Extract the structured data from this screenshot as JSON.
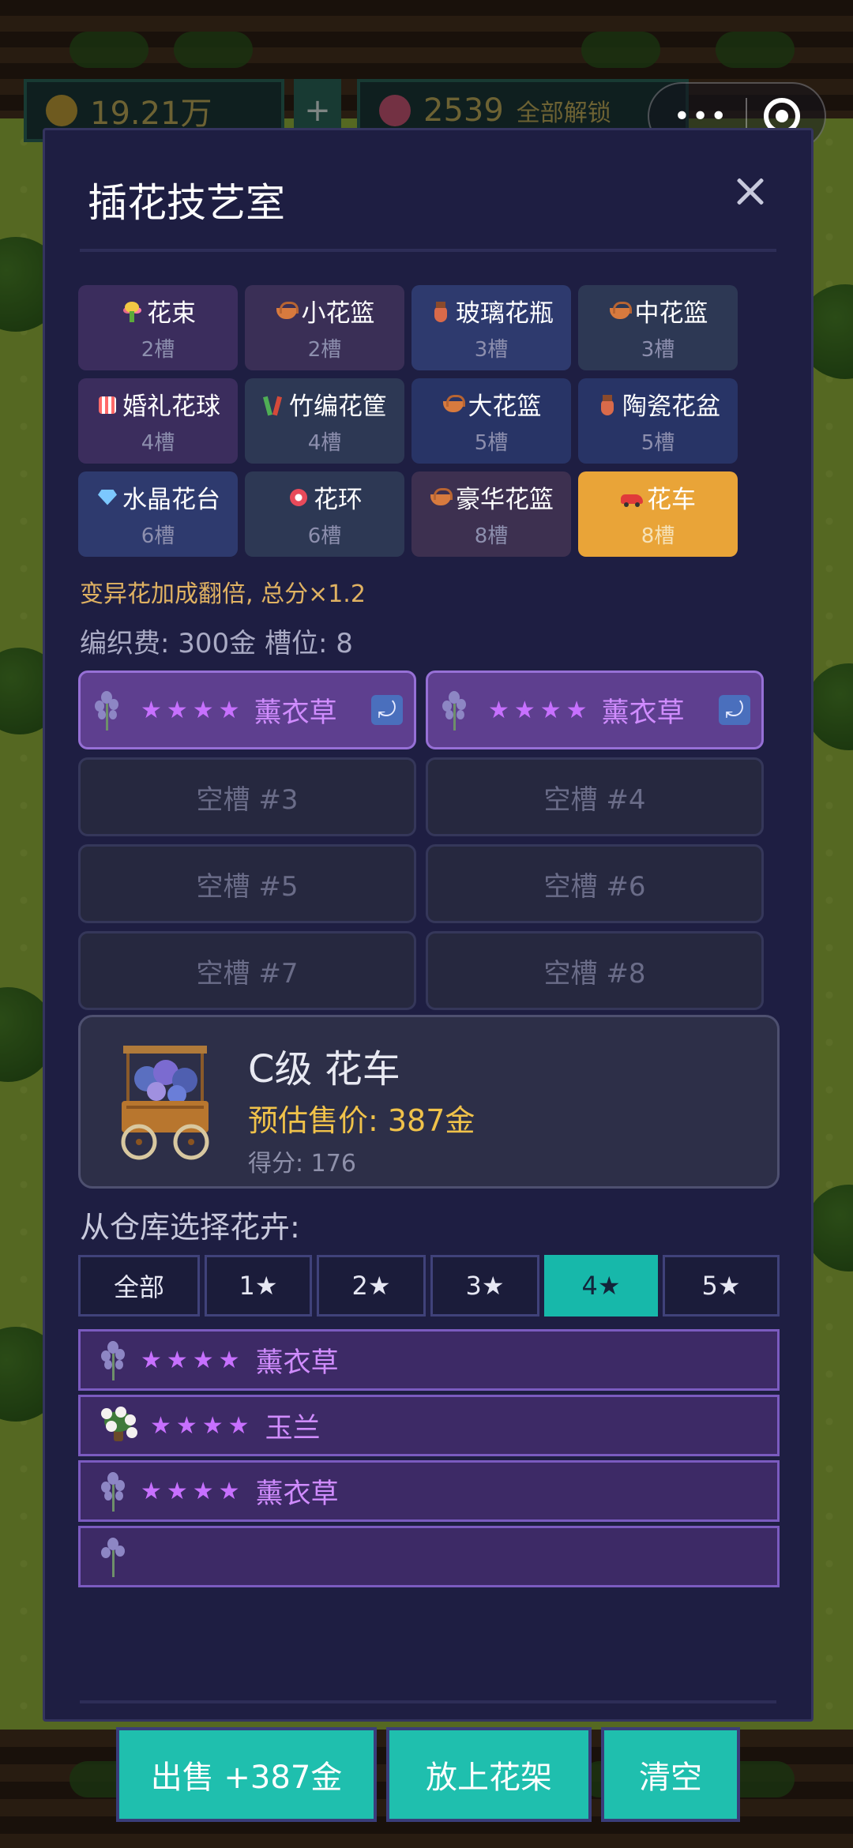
{
  "hud": {
    "coins": "19.21万",
    "plus": "+",
    "flowers": "2539",
    "unlock_all": "全部解锁"
  },
  "modal": {
    "title": "插花技艺室"
  },
  "types": [
    {
      "icon": "bouquet-icon",
      "name": "花束",
      "slots": "2槽"
    },
    {
      "icon": "basket-icon",
      "name": "小花篮",
      "slots": "2槽"
    },
    {
      "icon": "vase-icon",
      "name": "玻璃花瓶",
      "slots": "3槽"
    },
    {
      "icon": "basket-icon",
      "name": "中花篮",
      "slots": "3槽"
    },
    {
      "icon": "wedding-ball-icon",
      "name": "婚礼花球",
      "slots": "4槽"
    },
    {
      "icon": "bamboo-icon",
      "name": "竹编花筐",
      "slots": "4槽"
    },
    {
      "icon": "basket-icon",
      "name": "大花篮",
      "slots": "5槽"
    },
    {
      "icon": "vase-icon",
      "name": "陶瓷花盆",
      "slots": "5槽"
    },
    {
      "icon": "crystal-icon",
      "name": "水晶花台",
      "slots": "6槽"
    },
    {
      "icon": "wreath-icon",
      "name": "花环",
      "slots": "6槽"
    },
    {
      "icon": "basket-icon",
      "name": "豪华花篮",
      "slots": "8槽"
    },
    {
      "icon": "car-icon",
      "name": "花车",
      "slots": "8槽",
      "selected": true
    }
  ],
  "bonus_note": "变异花加成翻倍, 总分×1.2",
  "fee_note": "编织费: 300金  槽位: 8",
  "slots": [
    {
      "stars": "★★★★",
      "flower": "薰衣草",
      "undo": "⤾"
    },
    {
      "stars": "★★★★",
      "flower": "薰衣草",
      "undo": "⤾"
    },
    {
      "empty": "空槽 #3"
    },
    {
      "empty": "空槽 #4"
    },
    {
      "empty": "空槽 #5"
    },
    {
      "empty": "空槽 #6"
    },
    {
      "empty": "空槽 #7"
    },
    {
      "empty": "空槽 #8"
    }
  ],
  "preview": {
    "title": "C级 花车",
    "price": "预估售价: 387金",
    "score": "得分: 176"
  },
  "pick_label": "从仓库选择花卉:",
  "tabs": [
    "全部",
    "1★",
    "2★",
    "3★",
    "4★",
    "5★"
  ],
  "active_tab": "4★",
  "warehouse": [
    {
      "icon": "lavender-icon",
      "stars": "★★★★",
      "flower": "薰衣草"
    },
    {
      "icon": "magnolia-icon",
      "stars": "★★★★",
      "flower": "玉兰"
    },
    {
      "icon": "lavender-icon",
      "stars": "★★★★",
      "flower": "薰衣草"
    },
    {
      "icon": "lavender-icon",
      "stars": "",
      "flower": ""
    }
  ],
  "buttons": {
    "sell": "出售 +387金",
    "shelf": "放上花架",
    "clear": "清空"
  },
  "colors": {
    "modal_bg": "#1e1e42",
    "accent_teal": "#1fbfae",
    "gold": "#e9a438",
    "purple_flower": "#c770ff"
  }
}
